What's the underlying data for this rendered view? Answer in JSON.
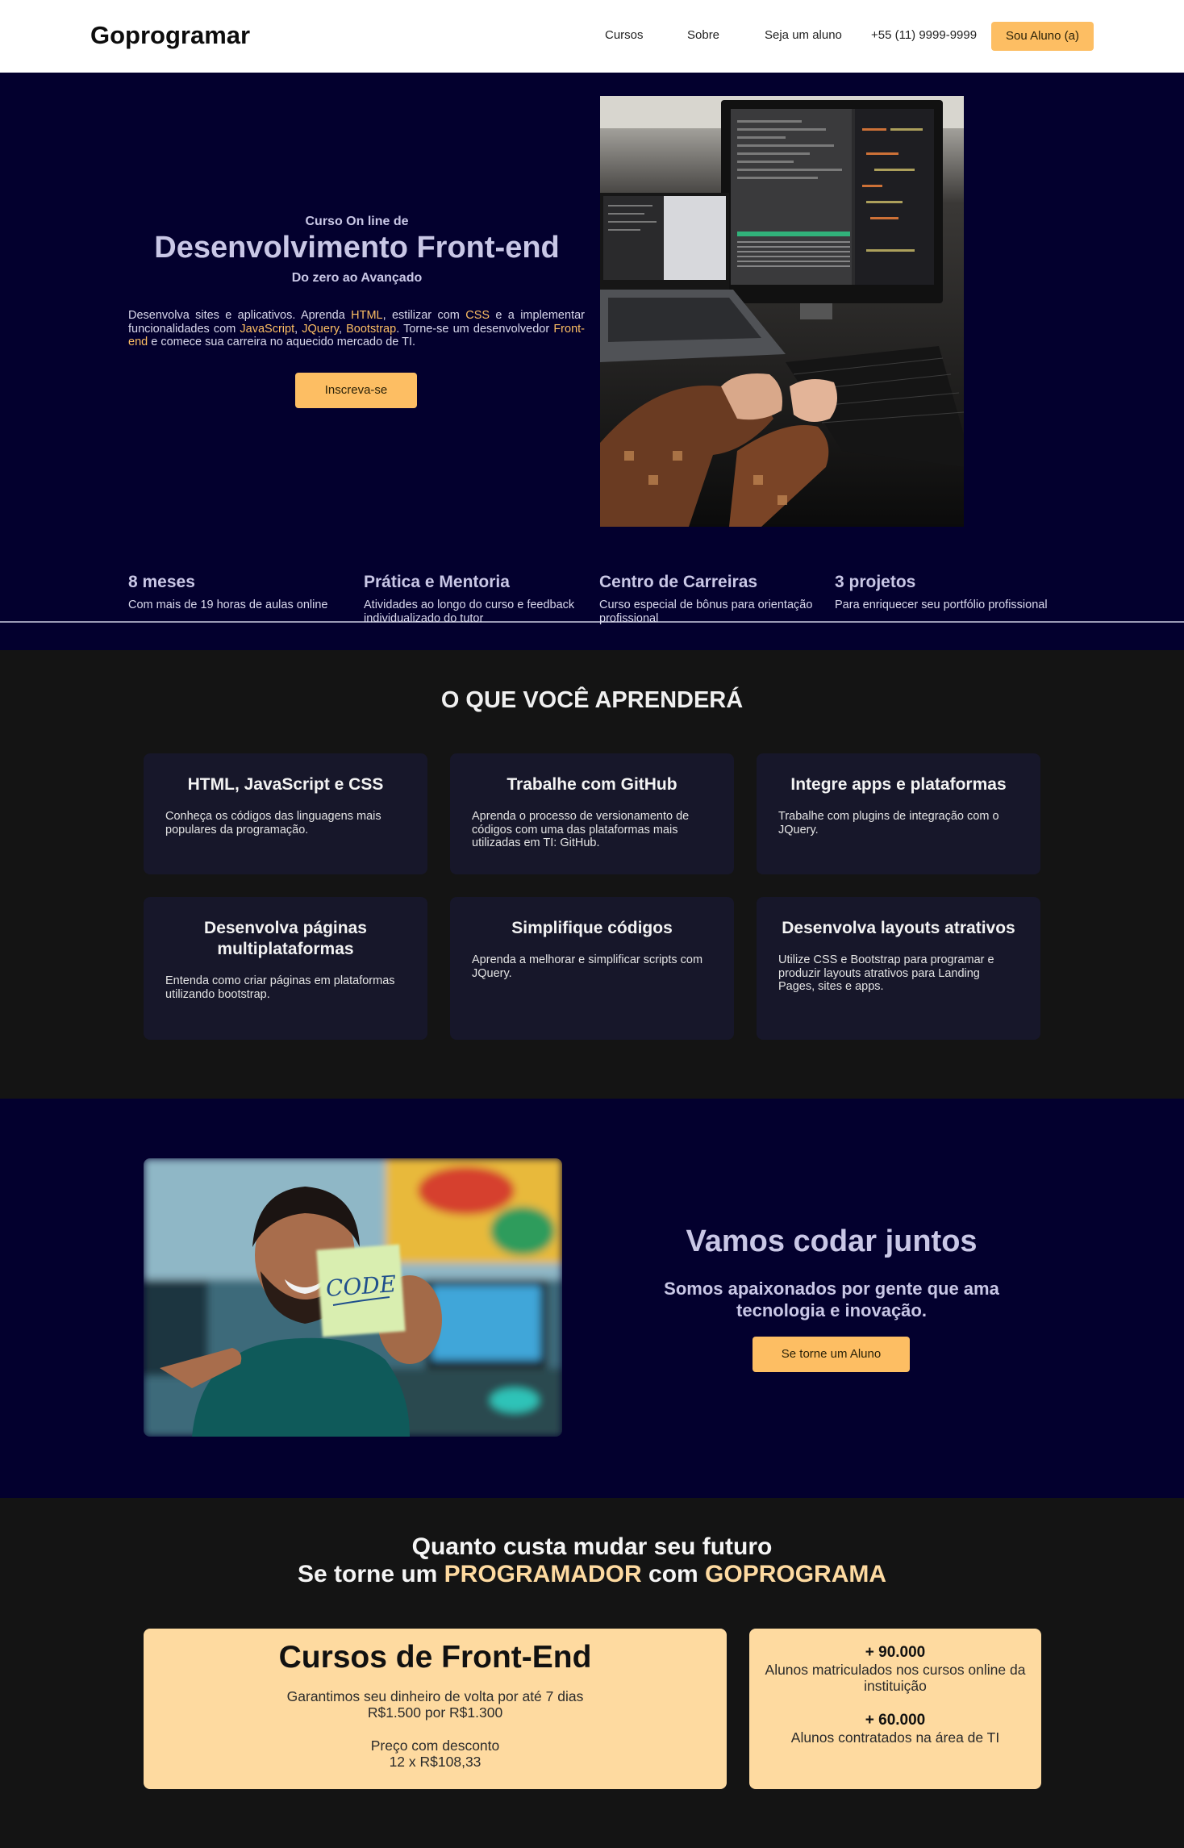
{
  "header": {
    "logo": "Goprogramar",
    "nav": [
      "Cursos",
      "Sobre",
      "Seja um aluno",
      "+55 (11) 9999-9999"
    ],
    "cta": "Sou Aluno (a)"
  },
  "hero": {
    "pre": "Curso On line de",
    "title": "Desenvolvimento Front-end",
    "subtitle": "Do zero ao Avançado",
    "desc": {
      "t1": "Desenvolva sites e aplicativos. Aprenda ",
      "h1": "HTML",
      "t2": ", estilizar com ",
      "h2": "CSS",
      "t3": " e a implementar funcionalidades com ",
      "h3": "JavaScript",
      "t4": ", ",
      "h4": "JQuery",
      "t5": ", ",
      "h5": "Bootstrap",
      "t6": ". Torne-se um desenvolvedor ",
      "h6": "Front-end",
      "t7": " e comece sua carreira no aquecido mercado de TI."
    },
    "button": "Inscreva-se",
    "features": [
      {
        "title": "8 meses",
        "desc": "Com mais de 19 horas de aulas online"
      },
      {
        "title": "Prática e Mentoria",
        "desc": "Atividades ao longo do curso e feedback individualizado do tutor"
      },
      {
        "title": "Centro de Carreiras",
        "desc": "Curso especial de bônus para orientação profissional"
      },
      {
        "title": "3 projetos",
        "desc": "Para enriquecer seu portfólio profissional"
      }
    ]
  },
  "learn": {
    "title": "O QUE VOCÊ APRENDERÁ",
    "cards": [
      {
        "title": "HTML, JavaScript e CSS",
        "desc": "Conheça os códigos das linguagens mais populares da programação."
      },
      {
        "title": "Trabalhe com GitHub",
        "desc": "Aprenda o processo de versionamento de códigos com uma das plataformas mais utilizadas em TI: GitHub."
      },
      {
        "title": "Integre apps e plataformas",
        "desc": "Trabalhe com plugins de integração com o JQuery."
      },
      {
        "title": "Desenvolva páginas multiplataformas",
        "desc": "Entenda como criar páginas em plataformas utilizando bootstrap."
      },
      {
        "title": "Simplifique códigos",
        "desc": "Aprenda a melhorar e simplificar scripts com JQuery."
      },
      {
        "title": "Desenvolva layouts atrativos",
        "desc": "Utilize CSS e Bootstrap para programar e produzir layouts atrativos para Landing Pages, sites e apps."
      }
    ]
  },
  "codar": {
    "title": "Vamos codar juntos",
    "subtitle": "Somos apaixonados por gente que ama tecnologia e inovação.",
    "button": "Se torne um Aluno",
    "sticky_note": "CODE"
  },
  "pricing": {
    "line1": "Quanto custa mudar seu futuro",
    "line2_a": "Se torne um ",
    "line2_h1": "PROGRAMADOR",
    "line2_b": " com ",
    "line2_h2": "GOPROGRAMA",
    "course_title": "Cursos de Front-End",
    "guarantee": "Garantimos seu dinheiro de volta por até 7 dias",
    "price_change": "R$1.500 por R$1.300",
    "discount_label": "Preço com desconto",
    "installments": "12 x R$108,33",
    "stats": [
      {
        "num": "+ 90.000",
        "text": "Alunos matriculados nos cursos online da instituição"
      },
      {
        "num": "+ 60.000",
        "text": "Alunos contratados na área de TI"
      }
    ]
  },
  "colors": {
    "accent": "#fdbe63",
    "navy": "#03002e",
    "dark": "#141414",
    "card": "#17172a",
    "cream": "#fedaa0"
  }
}
